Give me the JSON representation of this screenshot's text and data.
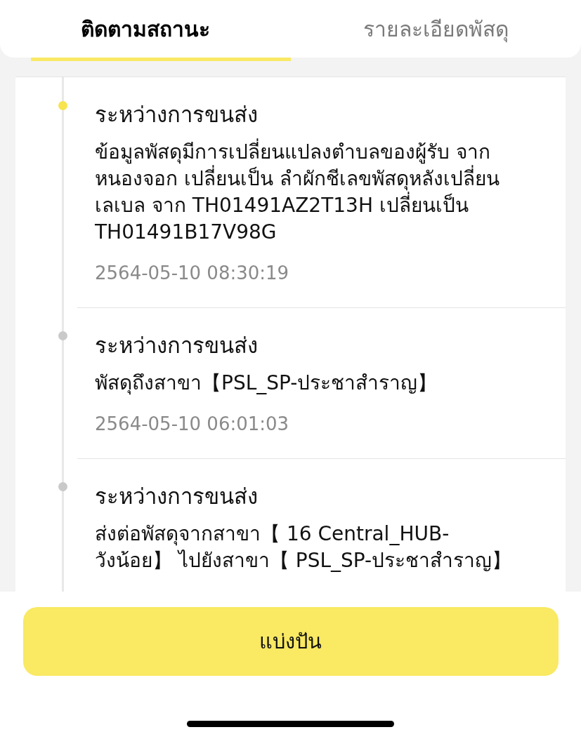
{
  "tabs": [
    {
      "label": "ติดตามสถานะ",
      "selected": true
    },
    {
      "label": "รายละเอียดพัสดุ",
      "selected": false
    }
  ],
  "timeline": [
    {
      "title": "ระหว่างการขนส่ง",
      "description": "ข้อมูลพัสดุมีการเปลี่ยนแปลงตำบลของผู้รับ จาก หนองจอก เปลี่ยนเป็น ลำผักชีเลขพัสดุหลังเปลี่ยนเลเบล จาก TH01491AZ2T13H เปลี่ยนเป็น TH01491B17V98G",
      "time": "2564-05-10 08:30:19",
      "current": true
    },
    {
      "title": "ระหว่างการขนส่ง",
      "description": "พัสดุถึงสาขา【PSL_SP-ประชาสำราญ】",
      "time": "2564-05-10 06:01:03",
      "current": false
    },
    {
      "title": "ระหว่างการขนส่ง",
      "description": "ส่งต่อพัสดุจากสาขา【 16 Central_HUB-วังน้อย】 ไปยังสาขา【 PSL_SP-ประชาสำราญ】",
      "current": false
    }
  ],
  "share_button": {
    "label": "แบ่งปัน"
  }
}
